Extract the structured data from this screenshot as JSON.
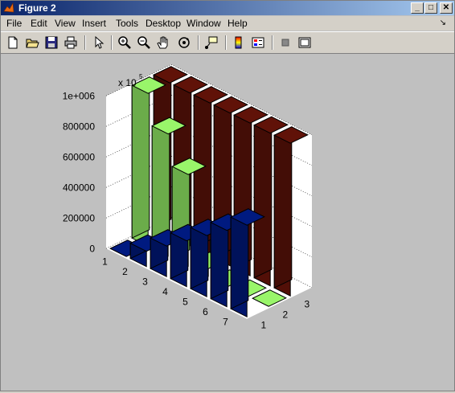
{
  "window": {
    "title": "Figure 2"
  },
  "menubar": {
    "items": [
      "File",
      "Edit",
      "View",
      "Insert",
      "Tools",
      "Desktop",
      "Window",
      "Help"
    ]
  },
  "toolbar": {
    "tools": [
      "new-file-icon",
      "open-folder-icon",
      "save-icon",
      "print-icon",
      "pointer-icon",
      "zoom-in-icon",
      "zoom-out-icon",
      "pan-hand-icon",
      "rotate-3d-icon",
      "data-cursor-icon",
      "colorbar-icon",
      "legend-icon",
      "hide-plot-tools-icon",
      "show-plot-tools-icon"
    ]
  },
  "colors": {
    "series1": "#001a80",
    "series2": "#99f56a",
    "series3": "#601208"
  },
  "chart_data": {
    "type": "bar3",
    "z_multiplier_label": "x 10",
    "z_multiplier_exp": "5",
    "z_ticks": [
      "0",
      "200000",
      "400000",
      "600000",
      "800000",
      "1e+006"
    ],
    "row_categories": [
      "1",
      "2",
      "3",
      "4",
      "5",
      "6",
      "7"
    ],
    "col_categories": [
      "1",
      "2",
      "3"
    ],
    "zlim": [
      0,
      1000000
    ],
    "series": [
      {
        "values": [
          0,
          100000,
          200000,
          300000,
          400000,
          500000,
          600000
        ]
      },
      {
        "values": [
          1000000,
          800000,
          600000,
          50000,
          0,
          0,
          0
        ]
      },
      {
        "values": [
          1000000,
          1000000,
          1000000,
          1000000,
          1000000,
          1000000,
          1000000
        ]
      }
    ]
  }
}
